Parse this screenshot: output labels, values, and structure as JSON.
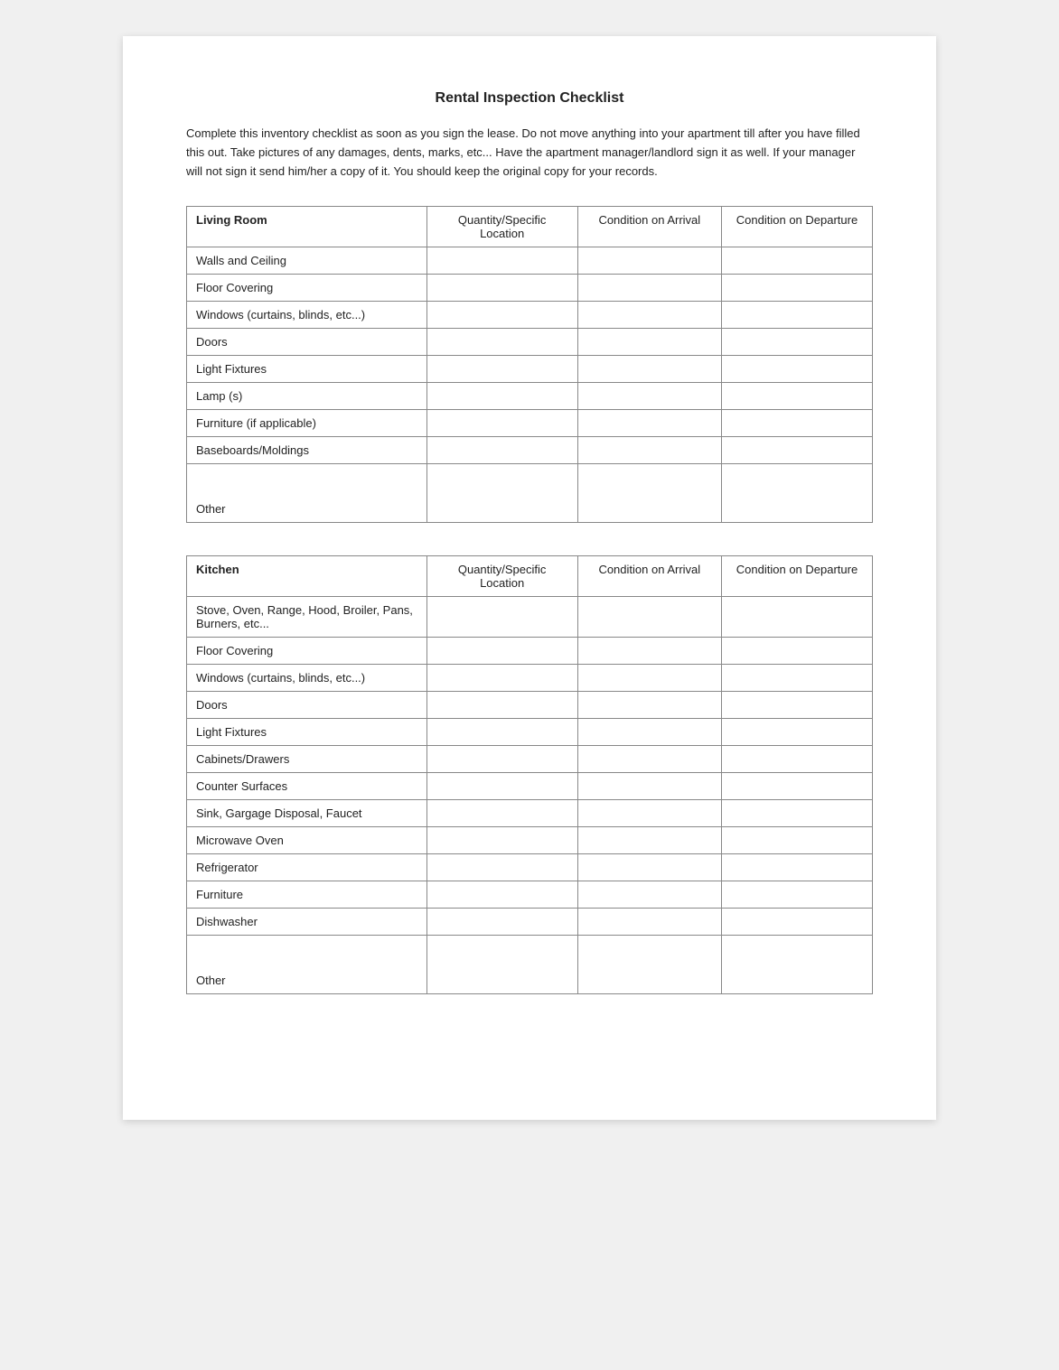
{
  "page": {
    "title": "Rental Inspection Checklist",
    "intro": "Complete this inventory checklist as soon as you sign the lease.  Do not move anything into your apartment till after you have filled this out.  Take pictures of any damages, dents, marks, etc... Have the apartment manager/landlord sign it as well.  If your manager will not sign it send him/her a copy of it.  You should keep the original copy for your records."
  },
  "living_room": {
    "section_label": "Living Room",
    "col_qty": "Quantity/Specific Location",
    "col_arrival": "Condition on Arrival",
    "col_departure": "Condition on Departure",
    "items": [
      "Walls and Ceiling",
      "Floor Covering",
      "Windows (curtains, blinds, etc...)",
      "Doors",
      "Light Fixtures",
      "Lamp (s)",
      "Furniture (if applicable)",
      "Baseboards/Moldings",
      "Other"
    ]
  },
  "kitchen": {
    "section_label": "Kitchen",
    "col_qty": "Quantity/Specific Location",
    "col_arrival": "Condition on Arrival",
    "col_departure": "Condition on Departure",
    "items": [
      "Stove, Oven, Range, Hood, Broiler, Pans, Burners, etc...",
      "Floor Covering",
      "Windows (curtains, blinds, etc...)",
      "Doors",
      "Light Fixtures",
      "Cabinets/Drawers",
      "Counter Surfaces",
      "Sink, Gargage Disposal, Faucet",
      "Microwave Oven",
      "Refrigerator",
      "Furniture",
      "Dishwasher",
      "Other"
    ]
  }
}
